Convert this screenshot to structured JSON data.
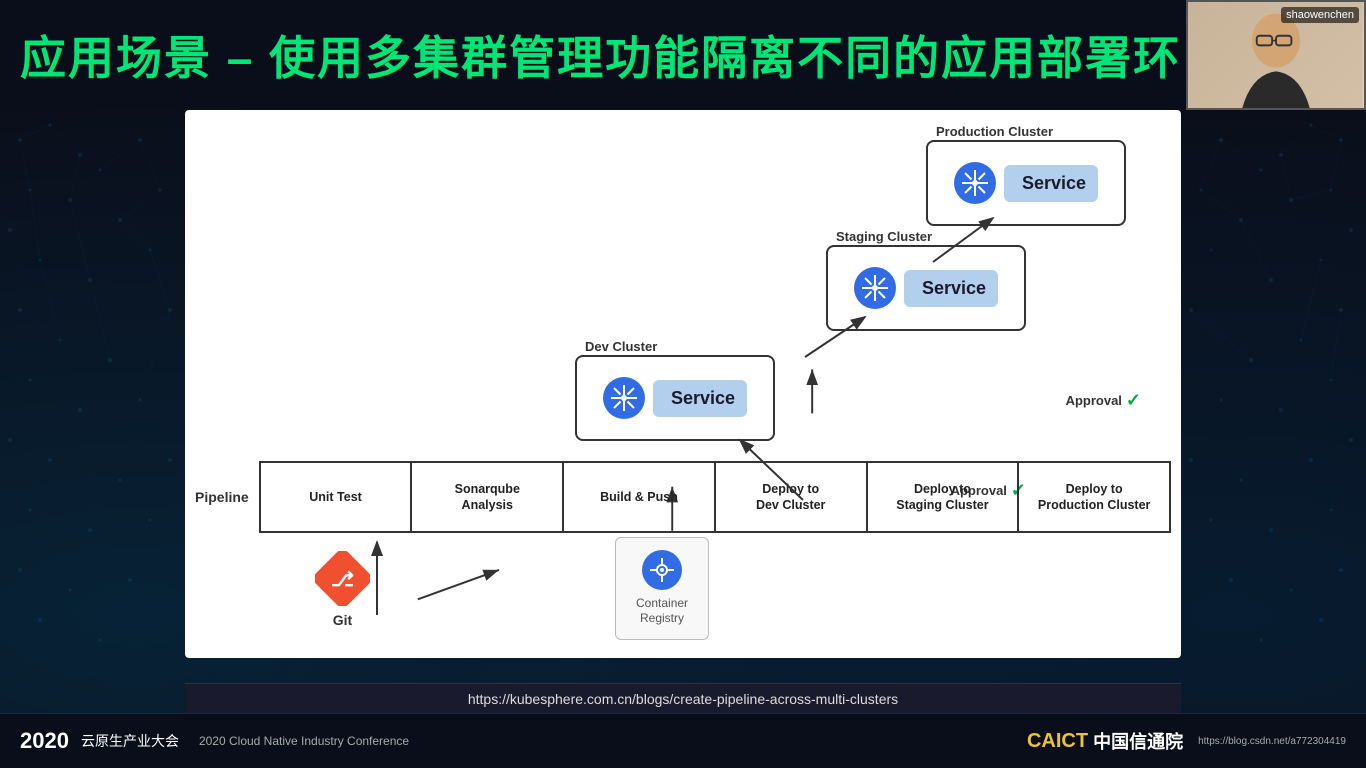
{
  "title": "应用场景 – 使用多集群管理功能隔离不同的应用部署环",
  "webcam": {
    "username": "shaowenchen"
  },
  "clusters": {
    "production": {
      "label": "Production Cluster",
      "service": "Service"
    },
    "staging": {
      "label": "Staging Cluster",
      "service": "Service"
    },
    "dev": {
      "label": "Dev Cluster",
      "service": "Service"
    }
  },
  "pipeline": {
    "label": "Pipeline",
    "stages": [
      {
        "id": "unit-test",
        "text": "Unit Test"
      },
      {
        "id": "sonarqube",
        "text": "Sonarqube\nAnalysis"
      },
      {
        "id": "build-push",
        "text": "Build & Push"
      },
      {
        "id": "deploy-dev",
        "text": "Deploy to\nDev Cluster"
      },
      {
        "id": "deploy-staging",
        "text": "Deploy to\nStaging Cluster"
      },
      {
        "id": "deploy-production",
        "text": "Deploy to\nProduction Cluster"
      }
    ]
  },
  "approvals": [
    {
      "id": "approval-1",
      "text": "Approval"
    },
    {
      "id": "approval-2",
      "text": "Approval"
    }
  ],
  "sources": {
    "git": {
      "label": "Git"
    },
    "registry": {
      "label": "Container\nRegistry"
    }
  },
  "bottom": {
    "year": "2020",
    "cn_text": "云原生产业大会",
    "en_text": "2020 Cloud Native Industry Conference",
    "url": "https://kubesphere.com.cn/blogs/create-pipeline-across-multi-clusters",
    "logo_caict": "CAICT",
    "logo_cn": "中国信通院",
    "blog_url": "https://blog.csdn.net/a772304419"
  }
}
